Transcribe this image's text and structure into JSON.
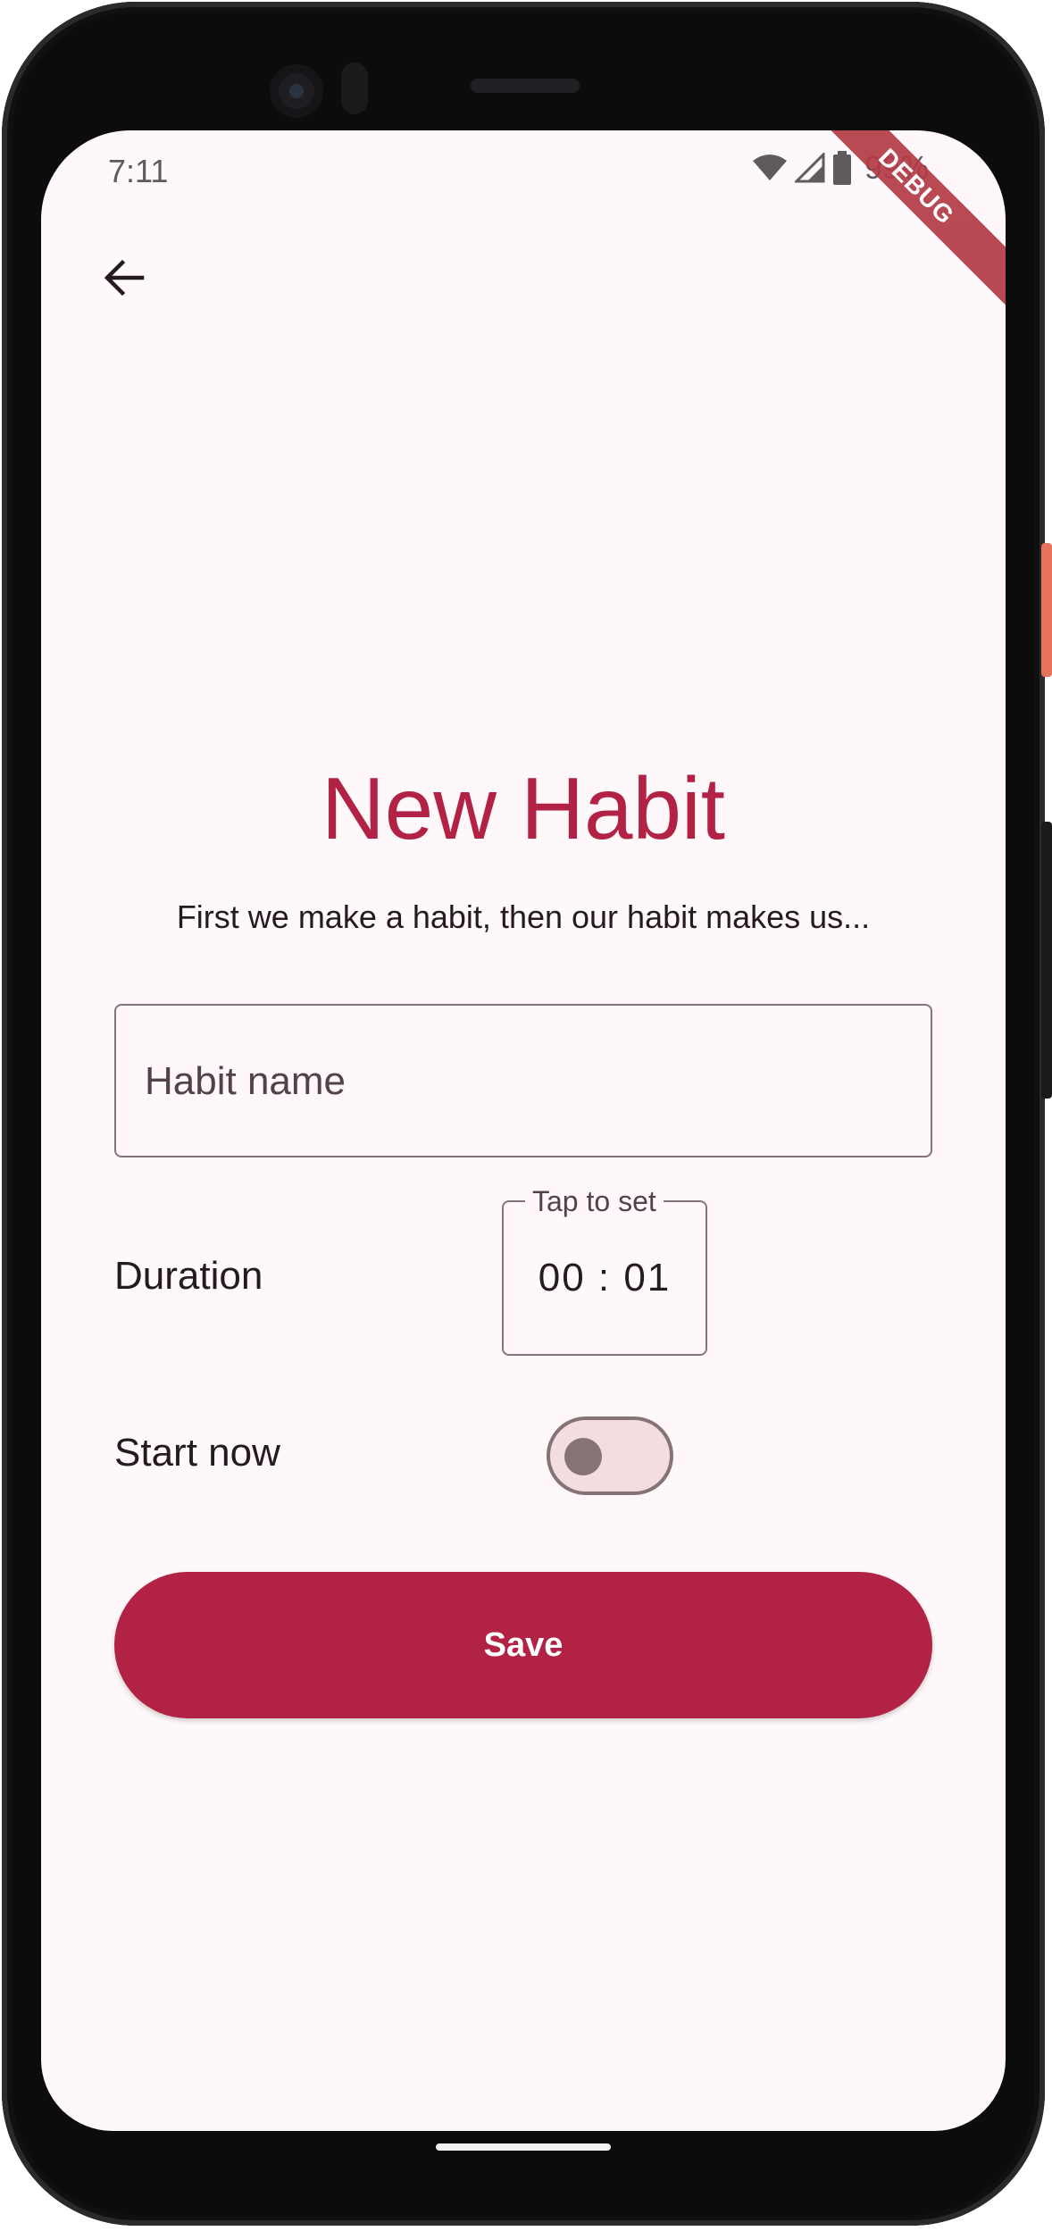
{
  "status_bar": {
    "time": "7:11",
    "battery_percent": "99%",
    "icons": [
      "wifi-icon",
      "cell-signal-icon",
      "battery-icon"
    ]
  },
  "debug_banner": "DEBUG",
  "app_bar": {
    "back_icon": "arrow-back-icon"
  },
  "page": {
    "title": "New Habit",
    "subtitle": "First we make a habit, then our habit makes us..."
  },
  "form": {
    "habit_name_placeholder": "Habit name",
    "habit_name_value": "",
    "duration_label": "Duration",
    "duration_legend": "Tap to set",
    "duration_value": "00 : 01",
    "start_now_label": "Start now",
    "start_now_on": false,
    "save_label": "Save"
  },
  "colors": {
    "primary": "#b22245",
    "background": "#fff8fa",
    "outline": "#857375",
    "switch_track": "#f3dde0",
    "text": "#231b1d"
  }
}
